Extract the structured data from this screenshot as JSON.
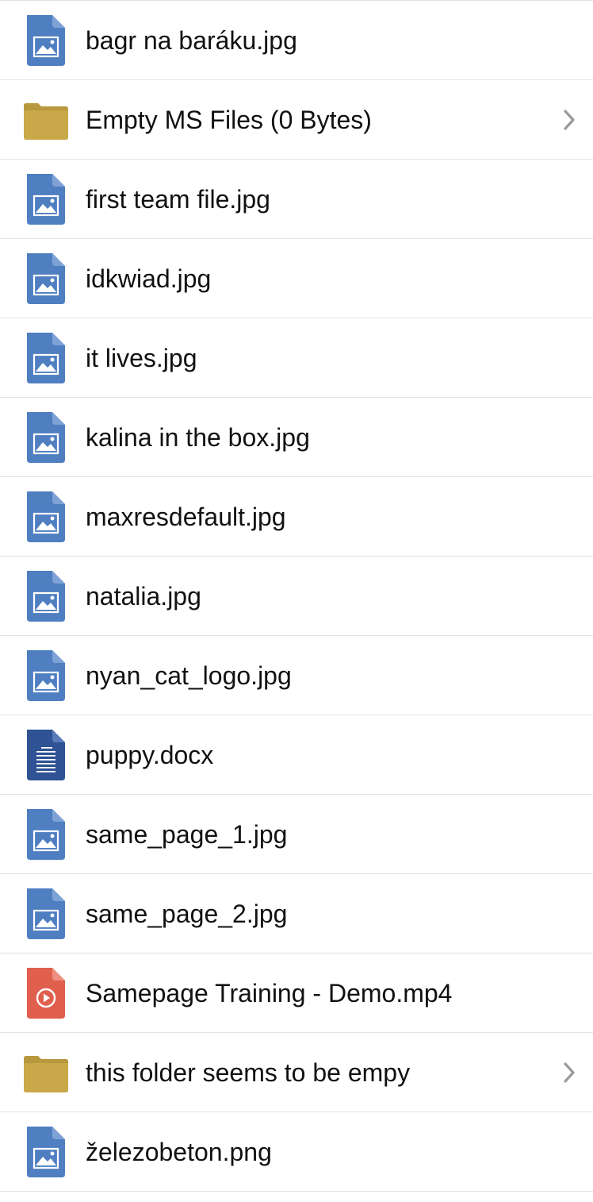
{
  "items": [
    {
      "name": "bagr na baráku.jpg",
      "kind": "image",
      "icon": "image-file-icon"
    },
    {
      "name": "Empty MS Files (0 Bytes)",
      "kind": "folder",
      "icon": "folder-icon"
    },
    {
      "name": "first team file.jpg",
      "kind": "image",
      "icon": "image-file-icon"
    },
    {
      "name": "idkwiad.jpg",
      "kind": "image",
      "icon": "image-file-icon"
    },
    {
      "name": "it lives.jpg",
      "kind": "image",
      "icon": "image-file-icon"
    },
    {
      "name": "kalina in the box.jpg",
      "kind": "image",
      "icon": "image-file-icon"
    },
    {
      "name": "maxresdefault.jpg",
      "kind": "image",
      "icon": "image-file-icon"
    },
    {
      "name": "natalia.jpg",
      "kind": "image",
      "icon": "image-file-icon"
    },
    {
      "name": "nyan_cat_logo.jpg",
      "kind": "image",
      "icon": "image-file-icon"
    },
    {
      "name": "puppy.docx",
      "kind": "doc",
      "icon": "document-file-icon"
    },
    {
      "name": "same_page_1.jpg",
      "kind": "image",
      "icon": "image-file-icon"
    },
    {
      "name": "same_page_2.jpg",
      "kind": "image",
      "icon": "image-file-icon"
    },
    {
      "name": "Samepage Training - Demo.mp4",
      "kind": "video",
      "icon": "video-file-icon"
    },
    {
      "name": "this folder seems to be empy",
      "kind": "folder",
      "icon": "folder-icon"
    },
    {
      "name": "železobeton.png",
      "kind": "image",
      "icon": "image-file-icon"
    }
  ],
  "colors": {
    "image_icon": "#4f7fc1",
    "image_fold": "#7ea2d6",
    "doc_icon": "#2f5394",
    "doc_fold": "#5a7bb8",
    "video_icon": "#e0604d",
    "video_fold": "#ee8f80",
    "folder_icon": "#c9a84a",
    "folder_tab": "#b8983d",
    "chevron": "#9a9a9a",
    "text": "#111111",
    "divider": "#e3e3e3"
  }
}
